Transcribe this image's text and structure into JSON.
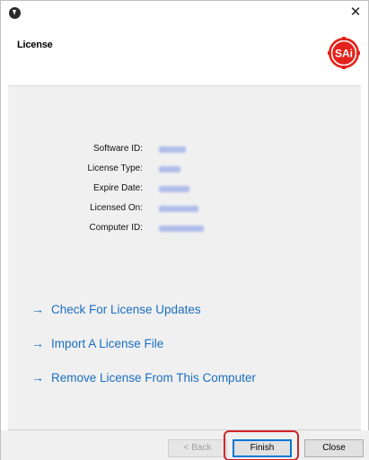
{
  "window": {
    "close_glyph": "✕"
  },
  "header": {
    "title": "License",
    "logo_text": "SAi",
    "logo_color": "#e3231b"
  },
  "license_info": [
    {
      "label": "Software ID:",
      "value": ""
    },
    {
      "label": "License Type:",
      "value": ""
    },
    {
      "label": "Expire Date:",
      "value": ""
    },
    {
      "label": "Licensed On:",
      "value": ""
    },
    {
      "label": "Computer ID:",
      "value": ""
    }
  ],
  "actions": [
    {
      "label": "Check For License Updates",
      "icon": "arrow-right-icon"
    },
    {
      "label": "Import A License File",
      "icon": "arrow-right-icon"
    },
    {
      "label": "Remove License From This Computer",
      "icon": "arrow-right-icon"
    }
  ],
  "footer": {
    "back_label": "< Back",
    "finish_label": "Finish",
    "close_label": "Close"
  },
  "colors": {
    "link": "#1b6fc2",
    "panel_bg": "#f0f0f0",
    "highlight": "#d0262a"
  }
}
